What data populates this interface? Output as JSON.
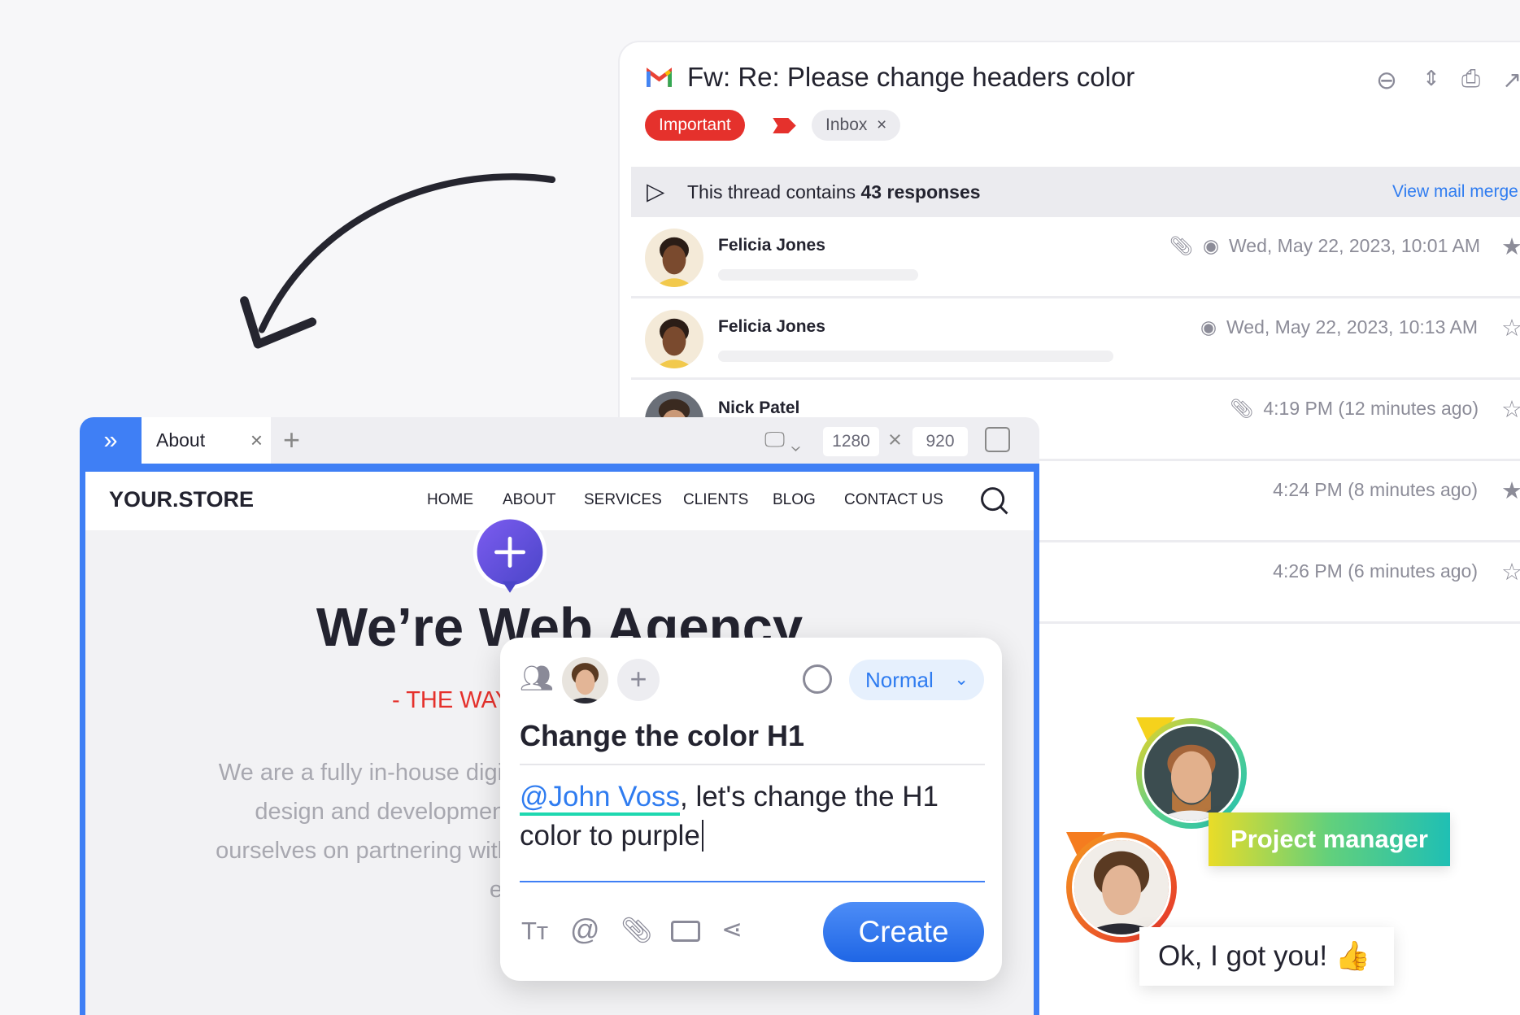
{
  "email": {
    "title": "Fw: Re: Please change headers color",
    "tags": {
      "important": "Important",
      "inbox": "Inbox",
      "inbox_remove": "×"
    },
    "thread": {
      "prefix": "This thread contains ",
      "count": "43 responses",
      "link": "View mail merge"
    },
    "rows": [
      {
        "name": "Felicia Jones",
        "time": "Wed, May 22, 2023, 10:01 AM",
        "attachment": true,
        "seen": true,
        "starred": true
      },
      {
        "name": "Felicia Jones",
        "time": "Wed, May 22, 2023, 10:13 AM",
        "attachment": false,
        "seen": true,
        "starred": false
      },
      {
        "name": "Nick Patel",
        "time": "4:19 PM (12 minutes ago)",
        "attachment": true,
        "starred": false
      },
      {
        "name": "",
        "time": "4:24 PM (8 minutes ago)",
        "starred": true
      },
      {
        "name": "",
        "time": "4:26 PM (6 minutes ago)",
        "starred": false
      }
    ]
  },
  "browser": {
    "tab": "About",
    "tab_close": "×",
    "width": "1280",
    "height": "920",
    "times": "×",
    "site": {
      "logo": "YOUR.STORE",
      "nav": [
        "HOME",
        "ABOUT",
        "SERVICES",
        "CLIENTS",
        "BLOG",
        "CONTACT US"
      ],
      "heading": "We’re Web Agency",
      "subheading": "- THE WAY",
      "paragraph": [
        "We are a fully in-house digital ag",
        "design and development with",
        "ourselves on partnering with clier",
        "educat"
      ]
    }
  },
  "comment": {
    "priority": "Normal",
    "title": "Change the color H1",
    "mention": "@John Voss",
    "text1": ", let's change the H1",
    "text2": "color to purple",
    "create": "Create"
  },
  "badges": {
    "role": "Project manager",
    "reply": "Ok, I got you! 👍"
  },
  "colors": {
    "accent": "#3f7ff5",
    "important": "#e5312c",
    "mention": "#2f7cf0",
    "pin": "#6a4fe0"
  }
}
